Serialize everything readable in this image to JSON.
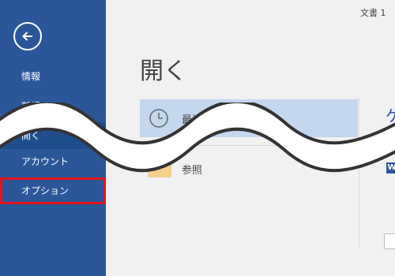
{
  "window": {
    "doc_title": "文書 1"
  },
  "nav": {
    "back_icon": "arrow-left-icon",
    "items": [
      {
        "label": "情報"
      },
      {
        "label": "新規"
      },
      {
        "label": "開く"
      },
      {
        "label": "アカウント"
      },
      {
        "label": "オプション"
      }
    ]
  },
  "main": {
    "title": "開く",
    "recent_label": "最近使ったアイテム",
    "browse_label": "参照",
    "pinned_heading": "ケ"
  },
  "colors": {
    "sidebar": "#2b579a",
    "sidebar_active": "#1e4e8c",
    "selected_item": "#c5d6ef",
    "highlight_box": "#e8141b",
    "folder": "#f4c26b"
  }
}
